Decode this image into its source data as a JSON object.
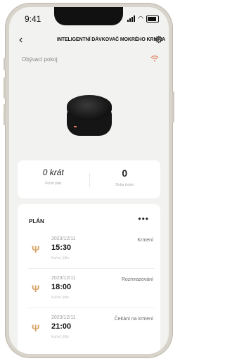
{
  "status": {
    "time": "9:41"
  },
  "header": {
    "back_icon": "‹",
    "title": "INTELIGENTNÍ DÁVKOVAČ MOKRÉHO KRMIVA",
    "settings_icon": "⚙"
  },
  "room": {
    "name": "Obývací pokoj",
    "wifi_icon": "wifi-icon"
  },
  "stats": {
    "count_value": "0 krát",
    "count_label": "Počet jídel",
    "duration_value": "0",
    "duration_label": "Doba trvání"
  },
  "plan": {
    "title": "PLÁN",
    "more": "•••",
    "rows": [
      {
        "date": "2023/12/11",
        "time": "15:30",
        "food": "Kuřecí jídlo",
        "label": "Krmení"
      },
      {
        "date": "2023/12/11",
        "time": "18:00",
        "food": "Kuřecí jídlo",
        "label": "Rozmrazování"
      },
      {
        "date": "2023/12/11",
        "time": "21:00",
        "food": "Kuřecí jídlo",
        "label": "Čekání na krmení"
      }
    ]
  },
  "colors": {
    "accent": "#e07a57",
    "fork": "#d9a56a"
  }
}
